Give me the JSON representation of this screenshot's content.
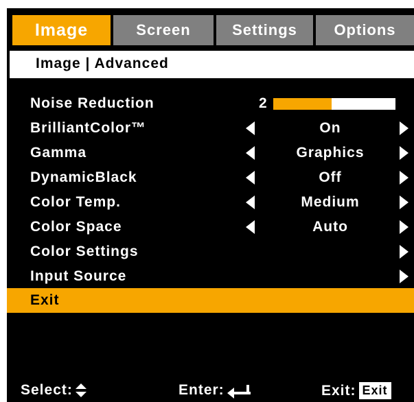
{
  "tabs": [
    {
      "label": "Image",
      "active": true
    },
    {
      "label": "Screen",
      "active": false
    },
    {
      "label": "Settings",
      "active": false
    },
    {
      "label": "Options",
      "active": false
    }
  ],
  "breadcrumb": "Image | Advanced",
  "menu": {
    "noise_reduction": {
      "label": "Noise Reduction",
      "value": "2",
      "level": 0.48
    },
    "brilliant_color": {
      "label": "BrilliantColor™",
      "value": "On"
    },
    "gamma": {
      "label": "Gamma",
      "value": "Graphics"
    },
    "dynamic_black": {
      "label": "DynamicBlack",
      "value": "Off"
    },
    "color_temp": {
      "label": "Color Temp.",
      "value": "Medium"
    },
    "color_space": {
      "label": "Color Space",
      "value": "Auto"
    },
    "color_settings": {
      "label": "Color Settings"
    },
    "input_source": {
      "label": "Input Source"
    },
    "exit": {
      "label": "Exit",
      "selected": true
    }
  },
  "footer": {
    "select_label": "Select:",
    "enter_label": "Enter:",
    "exit_label": "Exit:",
    "exit_key": "Exit"
  },
  "colors": {
    "accent": "#f7a600",
    "tab_inactive": "#808080",
    "background": "#000000"
  },
  "icons": [
    "left-arrow-icon",
    "right-arrow-icon",
    "up-down-icon",
    "enter-icon"
  ]
}
